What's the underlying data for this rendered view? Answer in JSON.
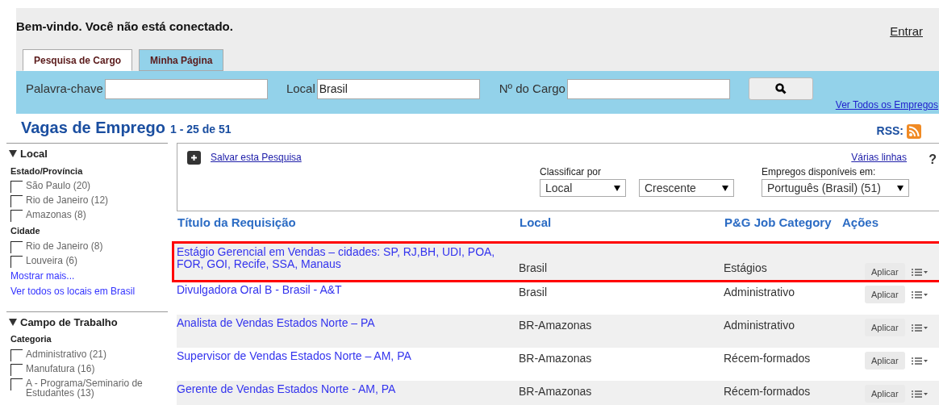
{
  "header": {
    "welcome": "Bem-vindo. Você não está conectado.",
    "login": "Entrar"
  },
  "tabs": [
    {
      "label": "Pesquisa de Cargo",
      "selected": true
    },
    {
      "label": "Minha Página",
      "selected": false
    }
  ],
  "search": {
    "keyword_label": "Palavra-chave",
    "location_label": "Local",
    "location_value": "Brasil",
    "job_number_label": "Nº do Cargo",
    "view_all": "Ver Todos os Empregos"
  },
  "results": {
    "title": "Vagas de Emprego",
    "range": "1 - 25 de 51",
    "rss": "RSS:"
  },
  "sidebar": [
    {
      "title": "Local",
      "expanded": true,
      "groups": [
        {
          "title": "Estado/Província",
          "items": [
            {
              "label": "São Paulo",
              "count": "(20)",
              "checked": false
            },
            {
              "label": "Rio de Janeiro",
              "count": "(12)",
              "checked": false
            },
            {
              "label": "Amazonas",
              "count": "(8)",
              "checked": false
            }
          ]
        },
        {
          "title": "Cidade",
          "items": [
            {
              "label": "Rio de Janeiro",
              "count": "(8)",
              "checked": false
            },
            {
              "label": "Louveira",
              "count": "(6)",
              "checked": false
            }
          ]
        }
      ],
      "links": [
        "Mostrar mais...",
        "Ver todos os locais em Brasil"
      ]
    },
    {
      "title": "Campo de Trabalho",
      "expanded": true,
      "groups": [
        {
          "title": "Categoria",
          "items": [
            {
              "label": "Administrativo",
              "count": "(21)",
              "checked": false
            },
            {
              "label": "Manufatura",
              "count": "(16)",
              "checked": false
            },
            {
              "label": "A - Programa/Seminario de Estudantes",
              "count": "(13)",
              "checked": false
            }
          ]
        }
      ]
    }
  ],
  "toolbar": {
    "save_search": "Salvar esta Pesquisa",
    "multi_line": "Várias linhas",
    "help": "?",
    "sort_label": "Classificar por",
    "sort_value": "Local",
    "order_value": "Crescente",
    "language_label": "Empregos disponíveis em:",
    "language_value": "Português (Brasil) (51)"
  },
  "table": {
    "columns": [
      "Título da Requisição",
      "Local",
      "P&G Job Category",
      "Ações"
    ],
    "rows": [
      {
        "title": "Estágio Gerencial em Vendas – cidades: SP, RJ,BH, UDI, POA, FOR, GOI, Recife, SSA, Manaus",
        "location": "Brasil",
        "category": "Estágios",
        "action": "Aplicar",
        "highlighted": true
      },
      {
        "title": "Divulgadora Oral B - Brasil - A&T",
        "location": "Brasil",
        "category": "Administrativo",
        "action": "Aplicar",
        "highlighted": false
      },
      {
        "title": "Analista de Vendas Estados Norte – PA",
        "location": "BR-Amazonas",
        "category": "Administrativo",
        "action": "Aplicar",
        "highlighted": false
      },
      {
        "title": "Supervisor de Vendas Estados Norte – AM, PA",
        "location": "BR-Amazonas",
        "category": "Récem-formados",
        "action": "Aplicar",
        "highlighted": false
      },
      {
        "title": "Gerente de Vendas Estados Norte - AM, PA",
        "location": "BR-Amazonas",
        "category": "Récem-formados",
        "action": "Aplicar",
        "highlighted": false
      }
    ]
  }
}
